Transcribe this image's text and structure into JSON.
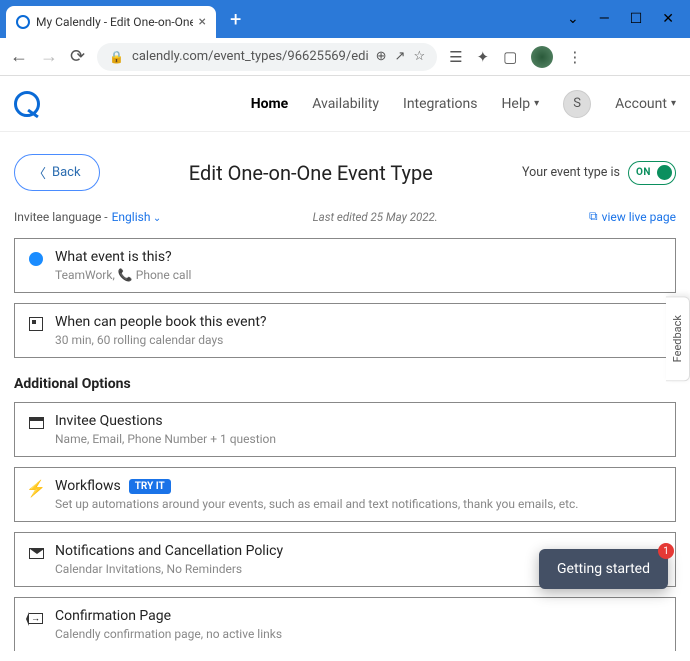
{
  "browser": {
    "tab_title": "My Calendly - Edit One-on-One |",
    "url": "calendly.com/event_types/96625569/edit?return_to=%...",
    "new_tab": "+",
    "win_min": "—",
    "win_max": "☐",
    "win_close": "✕"
  },
  "nav": {
    "home": "Home",
    "availability": "Availability",
    "integrations": "Integrations",
    "help": "Help",
    "account": "Account",
    "avatar_initial": "S"
  },
  "header": {
    "back": "Back",
    "title": "Edit One-on-One Event Type",
    "toggle_label_prefix": "Your event type is",
    "toggle_state": "ON"
  },
  "meta": {
    "language_label": "Invitee language -",
    "language_value": "English",
    "last_edited": "Last edited 25 May 2022.",
    "view_live": "view live page"
  },
  "cards": {
    "what": {
      "title": "What event is this?",
      "sub_prefix": "TeamWork,",
      "sub_suffix": "Phone call"
    },
    "when": {
      "title": "When can people book this event?",
      "sub": "30 min, 60 rolling calendar days"
    }
  },
  "additional": {
    "heading": "Additional Options",
    "invitee": {
      "title": "Invitee Questions",
      "sub": "Name, Email, Phone Number + 1 question"
    },
    "workflows": {
      "title": "Workflows",
      "badge": "TRY IT",
      "sub": "Set up automations around your events, such as email and text notifications, thank you emails, etc."
    },
    "notifications": {
      "title": "Notifications and Cancellation Policy",
      "sub": "Calendar Invitations, No Reminders"
    },
    "confirmation": {
      "title": "Confirmation Page",
      "sub": "Calendly confirmation page, no active links"
    }
  },
  "widgets": {
    "feedback": "Feedback",
    "getting_started": "Getting started",
    "gs_badge": "1"
  }
}
